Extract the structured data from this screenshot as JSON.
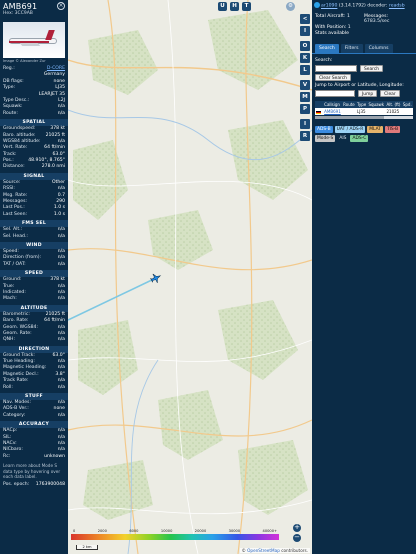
{
  "aircraft": {
    "callsign": "AMB691",
    "hex_line": "Hex: 3CC9AB",
    "photo_credit": "Image © Alexander Zur"
  },
  "info_rows": [
    {
      "label": "Reg.:",
      "value": "D-CORE",
      "link": true
    },
    {
      "label": "",
      "value": "Germany"
    },
    {
      "label": "DB flags:",
      "value": "none"
    },
    {
      "label": "Type:",
      "value": "LJ35"
    },
    {
      "label": "",
      "value": "LEARJET 35"
    },
    {
      "label": "Type Desc.:",
      "value": "L2J"
    },
    {
      "label": "Squawk:",
      "value": "n/a"
    },
    {
      "label": "Route:",
      "value": "n/a"
    }
  ],
  "sections": [
    {
      "title": "SPATIAL",
      "rows": [
        {
          "label": "Groundspeed:",
          "value": "378 kt"
        },
        {
          "label": "Baro. altitude:",
          "value": "21025 ft"
        },
        {
          "label": "WGS84 altitude:",
          "value": "n/a"
        },
        {
          "label": "Vert. Rate:",
          "value": "64 ft/min"
        },
        {
          "label": "Track:",
          "value": "63.0°"
        },
        {
          "label": "Pos.:",
          "value": "48.910°, 8.765°"
        },
        {
          "label": "Distance:",
          "value": "278.0 nmi"
        }
      ]
    },
    {
      "title": "SIGNAL",
      "rows": [
        {
          "label": "Source:",
          "value": "Other"
        },
        {
          "label": "RSSI:",
          "value": "n/a"
        },
        {
          "label": "Msg. Rate:",
          "value": "0.7"
        },
        {
          "label": "Messages:",
          "value": "290"
        },
        {
          "label": "Last Pos.:",
          "value": "1.0 s"
        },
        {
          "label": "Last Seen:",
          "value": "1.0 s"
        }
      ]
    },
    {
      "title": "FMS SEL",
      "rows": [
        {
          "label": "Sel. Alt.:",
          "value": "n/a"
        },
        {
          "label": "Sel. Head.:",
          "value": "n/a"
        }
      ]
    },
    {
      "title": "WIND",
      "rows": [
        {
          "label": "Speed:",
          "value": "n/a"
        },
        {
          "label": "Direction (from):",
          "value": "n/a"
        },
        {
          "label": "TAT / OAT:",
          "value": "n/a"
        }
      ]
    },
    {
      "title": "SPEED",
      "rows": [
        {
          "label": "Ground:",
          "value": "378 kt"
        },
        {
          "label": "True:",
          "value": "n/a"
        },
        {
          "label": "Indicated:",
          "value": "n/a"
        },
        {
          "label": "Mach:",
          "value": "n/a"
        }
      ]
    },
    {
      "title": "ALTITUDE",
      "rows": [
        {
          "label": "Barometric:",
          "value": "21025 ft"
        },
        {
          "label": "Baro. Rate:",
          "value": "64 ft/min"
        },
        {
          "label": "Geom. WGS84:",
          "value": "n/a"
        },
        {
          "label": "Geom. Rate:",
          "value": "n/a"
        },
        {
          "label": "QNH:",
          "value": "n/a"
        }
      ]
    },
    {
      "title": "DIRECTION",
      "rows": [
        {
          "label": "Ground Track:",
          "value": "63.0°"
        },
        {
          "label": "True Heading:",
          "value": "n/a"
        },
        {
          "label": "Magnetic Heading:",
          "value": "n/a"
        },
        {
          "label": "Magnetic Decl.:",
          "value": "3.8°"
        },
        {
          "label": "Track Rate:",
          "value": "n/a"
        },
        {
          "label": "Roll:",
          "value": "n/a"
        }
      ]
    },
    {
      "title": "STUFF",
      "rows": [
        {
          "label": "Nav. Modes:",
          "value": "n/a"
        },
        {
          "label": "ADS-B Ver.:",
          "value": "none"
        },
        {
          "label": "Category:",
          "value": "n/a"
        }
      ]
    },
    {
      "title": "ACCURACY",
      "rows": [
        {
          "label": "NACp:",
          "value": "n/a"
        },
        {
          "label": "SIL:",
          "value": "n/a"
        },
        {
          "label": "NACv:",
          "value": "n/a"
        },
        {
          "label": "NICbaro:",
          "value": "n/a"
        },
        {
          "label": "Rc:",
          "value": "unknown"
        }
      ]
    }
  ],
  "left_note": "Learn more about Mode S data type by hovering over each data label.",
  "pos_epoch": {
    "label": "Pos. epoch:",
    "value": "1763900048"
  },
  "map": {
    "top_buttons": [
      "U",
      "H",
      "T"
    ],
    "toolbar": [
      "<",
      "I",
      "O",
      "K",
      "L",
      "V",
      "M",
      "P",
      "I",
      "R"
    ],
    "zoom_in": "+",
    "zoom_out": "−",
    "scale_label": "2 km",
    "attribution_prefix": "© ",
    "attribution_link": "OpenStreetMap",
    "attribution_suffix": " contributors.",
    "colorbar_labels": [
      "0",
      "2000",
      "6000",
      "10000",
      "20000",
      "30000",
      "40000+"
    ],
    "track_color": "#7ec8e3",
    "aircraft_color": "#1e88e5"
  },
  "right": {
    "app_link": "ar1090",
    "version": "(3.14.1792) decoder:",
    "readsb": "readsb",
    "stats": [
      {
        "label": "Total Aircraft:",
        "value": "1"
      },
      {
        "label": "Messages:",
        "value": "6783.5/sec"
      },
      {
        "label": "With Position:",
        "value": "1"
      },
      {
        "label": "",
        "value": ""
      },
      {
        "label": "Stats available",
        "value": ""
      }
    ],
    "tabs": [
      "Search",
      "Filters",
      "Columns"
    ],
    "search_label": "Search:",
    "search_button": "Search",
    "clear_search": "Clear Search",
    "jump_label": "Jump to Airport or Latitude, Longitude:",
    "jump_button": "Jump",
    "clear_button": "Clear",
    "table_headers": [
      "",
      "Callsign",
      "Route",
      "Type",
      "Squawk",
      "Alt. (ft)",
      "Spd."
    ],
    "table_rows": [
      {
        "flag": "DE",
        "callsign": "AMB691",
        "route": "",
        "type": "LJ35",
        "squawk": "",
        "alt": "21025",
        "spd": ""
      }
    ],
    "chips": [
      {
        "label": "ADS-B",
        "kind": "adsb"
      },
      {
        "label": "UAT / ADS-R",
        "kind": "uat"
      },
      {
        "label": "MLAT",
        "kind": "mlat"
      },
      {
        "label": "TIS-B",
        "kind": "tisb"
      },
      {
        "label": "Mode-S",
        "kind": "modes"
      },
      {
        "label": "AIS",
        "kind": "ais"
      },
      {
        "label": "ADS-C",
        "kind": "adsc"
      }
    ]
  }
}
